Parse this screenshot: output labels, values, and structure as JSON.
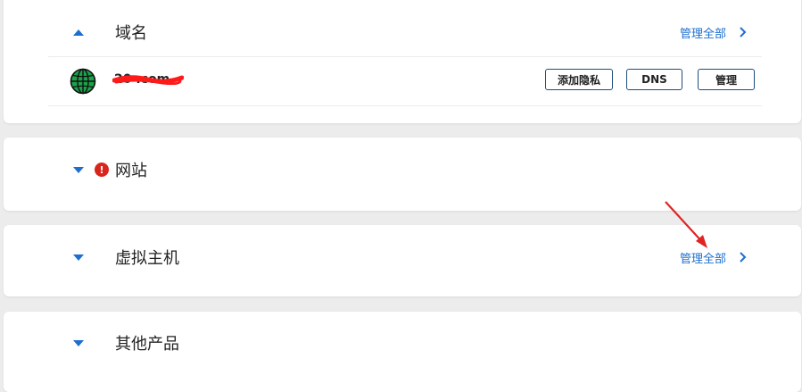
{
  "sections": {
    "domain": {
      "title": "域名",
      "manage_all": "管理全部",
      "expanded": true,
      "items": [
        {
          "name": "20      .com",
          "buttons": {
            "privacy": "添加隐私",
            "dns": "DNS",
            "manage": "管理"
          }
        }
      ]
    },
    "website": {
      "title": "网站",
      "expanded": false,
      "alert_icon": "exclamation-icon"
    },
    "hosting": {
      "title": "虚拟主机",
      "manage_all": "管理全部",
      "expanded": false
    },
    "other": {
      "title": "其他产品",
      "expanded": false
    }
  },
  "colors": {
    "accent": "#1d6fce",
    "alert": "#d9261c",
    "annotation": "#e02424",
    "globe": "#1aa34a"
  }
}
